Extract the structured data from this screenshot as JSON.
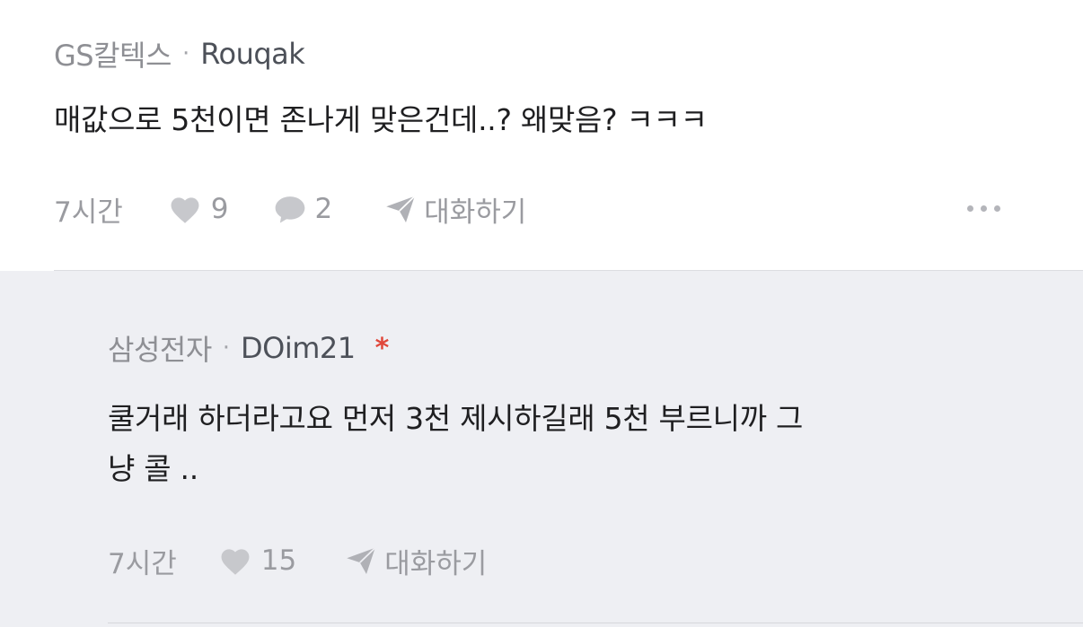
{
  "comment": {
    "company": "GS칼텍스",
    "separator": "·",
    "author": "Rouqak",
    "text": "매값으로 5천이면 존나게 맞은건데..? 왜맞음? ㅋㅋㅋ",
    "time": "7시간",
    "likes": "9",
    "replies": "2",
    "chat_label": "대화하기",
    "icons": [
      "heart-icon",
      "speech-bubble-icon",
      "paper-plane-icon",
      "more-dots-icon"
    ]
  },
  "reply": {
    "company": "삼성전자",
    "separator": "·",
    "author": "DOim21",
    "badge": "*",
    "text_line1": "쿨거래 하더라고요 먼저 3천 제시하길래 5천 부르니까 그",
    "text_line2": "냥 콜 ..",
    "time": "7시간",
    "likes": "15",
    "chat_label": "대화하기",
    "icons": [
      "heart-icon",
      "paper-plane-icon"
    ]
  },
  "colors": {
    "background": "#ffffff",
    "reply_background": "#eeeff3",
    "meta_gray": "#8e8f94",
    "author_dark": "#4d5159",
    "body_text": "#1f1f21",
    "action_gray": "#9a9ba0",
    "badge_red": "#e0473a"
  }
}
